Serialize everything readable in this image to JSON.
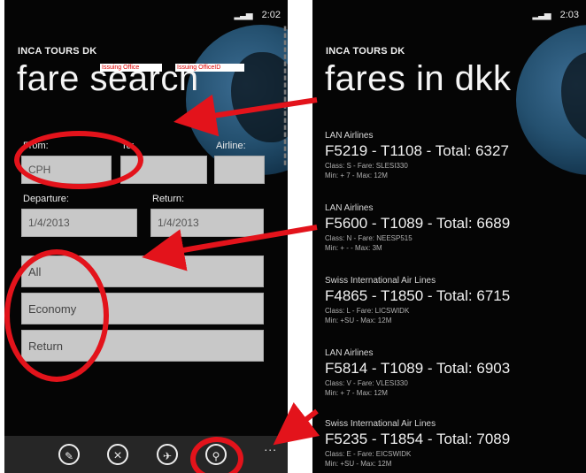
{
  "status": {
    "signal_icon": "signal-icon",
    "time": "2:02",
    "time_right": "2:03"
  },
  "left": {
    "app_title": "INCA TOURS DK",
    "page_title": "fare search",
    "tags": [
      "Issuing Office",
      "Issuing OfficeID"
    ],
    "labels": {
      "from": "From:",
      "to": "To:",
      "airline": "Airline:",
      "departure": "Departure:",
      "return": "Return:"
    },
    "fields": {
      "from": "CPH",
      "to": "",
      "airline": "",
      "departure": "1/4/2013",
      "return": "1/4/2013"
    },
    "selects": [
      "All",
      "Economy",
      "Return"
    ],
    "appbar": {
      "buttons": [
        {
          "name": "edit-icon",
          "glyph": "✎"
        },
        {
          "name": "close-icon",
          "glyph": "×"
        },
        {
          "name": "plane-icon",
          "glyph": "✈"
        },
        {
          "name": "search-icon",
          "glyph": "⚲"
        }
      ],
      "more": "..."
    }
  },
  "right": {
    "app_title": "INCA TOURS DK",
    "page_title": "fares in dkk",
    "fares": [
      {
        "airline": "LAN Airlines",
        "code": "F5219 - T1108 - Total: 6327",
        "class_line": "Class: S - Fare: SLESI330",
        "min_line": "Min: + 7 - Max: 12M"
      },
      {
        "airline": "LAN Airlines",
        "code": "F5600 - T1089 - Total: 6689",
        "class_line": "Class: N - Fare: NEESP515",
        "min_line": "Min: + - - Max: 3M"
      },
      {
        "airline": "Swiss International Air Lines",
        "code": "F4865 - T1850 - Total: 6715",
        "class_line": "Class: L - Fare: LICSWIDK",
        "min_line": "Min: +SU - Max: 12M"
      },
      {
        "airline": "LAN Airlines",
        "code": "F5814 - T1089 - Total: 6903",
        "class_line": "Class: V - Fare: VLESI330",
        "min_line": "Min: + 7 - Max: 12M"
      },
      {
        "airline": "Swiss International Air Lines",
        "code": "F5235 - T1854 - Total: 7089",
        "class_line": "Class: E - Fare: EICSWIDK",
        "min_line": "Min: +SU - Max: 12M"
      }
    ]
  },
  "colors": {
    "annotation": "#e3131b",
    "field_bg": "#c8c8c8",
    "app_bg": "#050505",
    "globe": "#2c5b80"
  }
}
